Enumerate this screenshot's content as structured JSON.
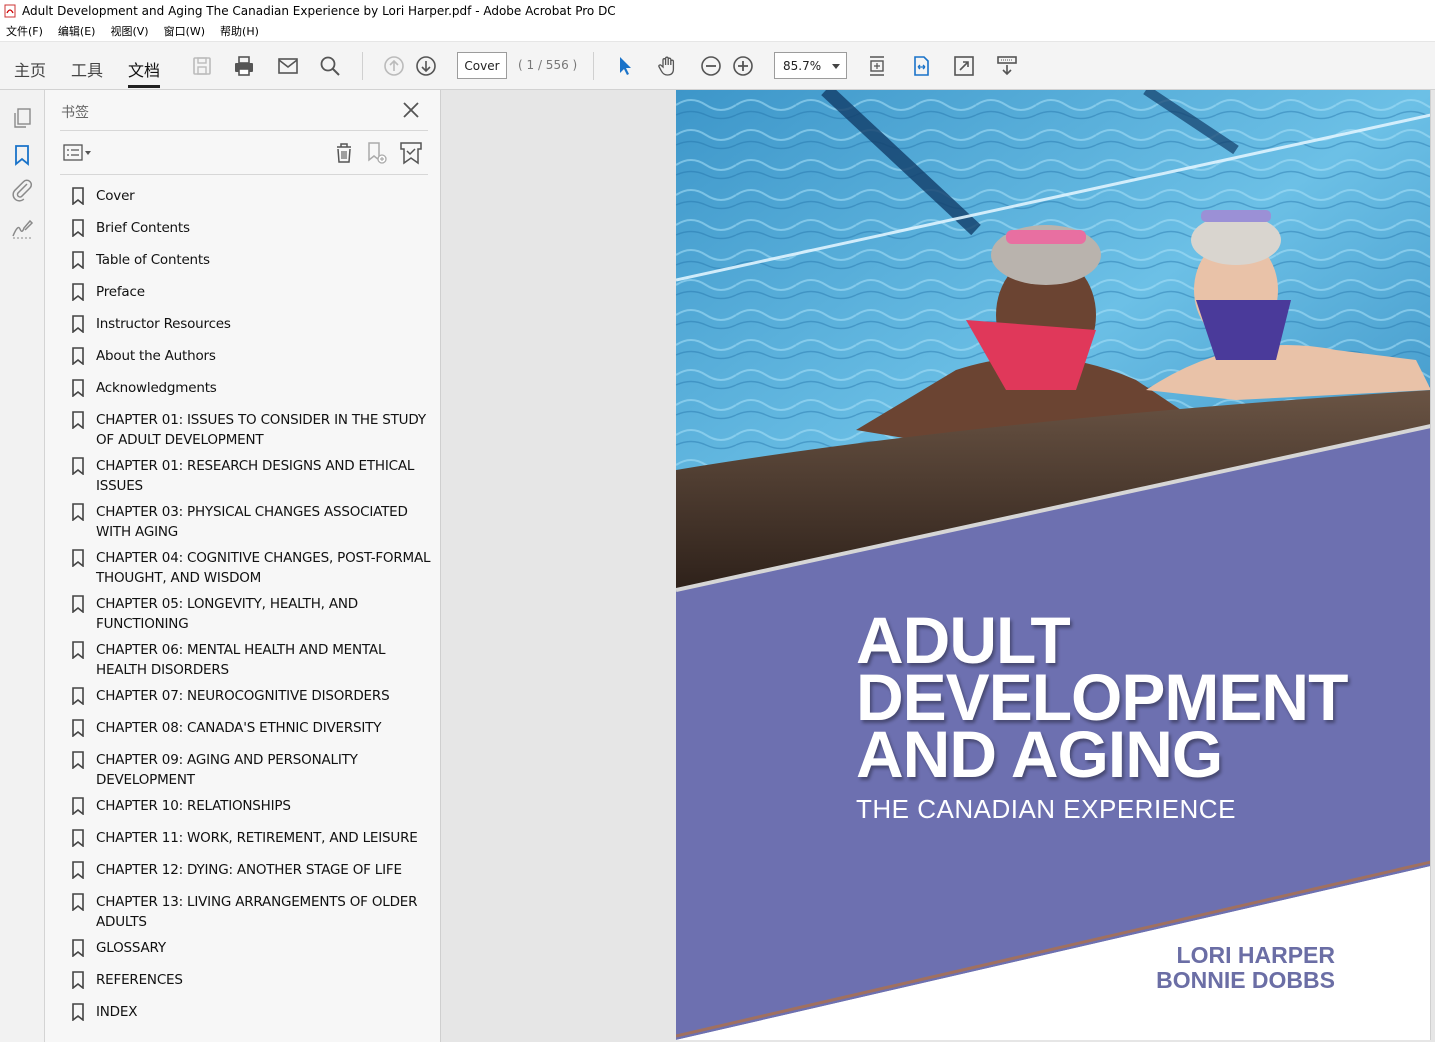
{
  "window": {
    "title": "Adult Development and Aging The Canadian Experience by Lori Harper.pdf - Adobe Acrobat Pro DC"
  },
  "menu": [
    "文件(F)",
    "编辑(E)",
    "视图(V)",
    "窗口(W)",
    "帮助(H)"
  ],
  "toolbar": {
    "tabs": [
      "主页",
      "工具",
      "文档"
    ],
    "active_tab": "文档",
    "page_field": "Cover",
    "page_count": "( 1 / 556 )",
    "zoom": "85.7%"
  },
  "bookmarks": {
    "header": "书签",
    "items": [
      "Cover",
      "Brief Contents",
      "Table of Contents",
      "Preface",
      "Instructor Resources",
      "About the Authors",
      "Acknowledgments",
      "CHAPTER 01: ISSUES TO CONSIDER IN THE STUDY OF ADULT DEVELOPMENT",
      "CHAPTER 01: RESEARCH DESIGNS AND ETHICAL ISSUES",
      "CHAPTER 03: PHYSICAL CHANGES ASSOCIATED WITH AGING",
      "CHAPTER 04: COGNITIVE CHANGES, POST-FORMAL THOUGHT, AND WISDOM",
      "CHAPTER 05: LONGEVITY, HEALTH, AND FUNCTIONING",
      "CHAPTER 06: MENTAL HEALTH AND MENTAL HEALTH DISORDERS",
      "CHAPTER 07: NEUROCOGNITIVE DISORDERS",
      "CHAPTER 08: CANADA'S ETHNIC DIVERSITY",
      "CHAPTER 09: AGING AND PERSONALITY DEVELOPMENT",
      "CHAPTER 10: RELATIONSHIPS",
      "CHAPTER 11: WORK, RETIREMENT, AND LEISURE",
      "CHAPTER 12: DYING: ANOTHER STAGE OF LIFE",
      "CHAPTER 13: LIVING ARRANGEMENTS OF OLDER ADULTS",
      "GLOSSARY",
      "REFERENCES",
      "INDEX"
    ]
  },
  "cover": {
    "title_lines": [
      "ADULT",
      "DEVELOPMENT",
      "AND AGING"
    ],
    "subtitle": "THE CANADIAN EXPERIENCE",
    "authors": [
      "LORI HARPER",
      "BONNIE DOBBS"
    ]
  },
  "colors": {
    "accent_blue": "#1a73c9",
    "cover_purple": "#6d70b0",
    "author_purple": "#6b6ea5"
  },
  "icons": {
    "left_rail": [
      "pages-icon",
      "bookmark-icon",
      "attachment-icon",
      "signature-icon"
    ],
    "toolbar": [
      "save-icon",
      "print-icon",
      "email-icon",
      "search-icon",
      "page-up-icon",
      "page-down-icon",
      "select-arrow-icon",
      "hand-icon",
      "zoom-out-icon",
      "zoom-in-icon",
      "fit-page-icon",
      "fit-width-icon",
      "fullscreen-icon",
      "read-mode-icon"
    ]
  }
}
